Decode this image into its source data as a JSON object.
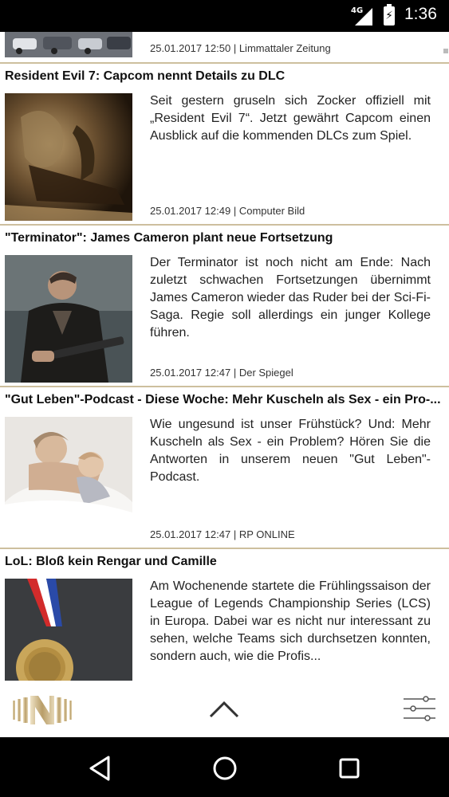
{
  "status_bar": {
    "network": "4G",
    "time": "1:36"
  },
  "articles": [
    {
      "title": "",
      "teaser": "",
      "date": "25.01.2017 12:50",
      "source": "Limmattaler Zeitung"
    },
    {
      "title": "Resident Evil 7: Capcom nennt Details zu DLC",
      "teaser": "Seit gestern gruseln sich Zocker offiziell mit „Resident Evil 7“. Jetzt gewährt Capcom einen Ausblick auf die kommenden DLCs zum Spiel.",
      "date": "25.01.2017 12:49",
      "source": "Computer Bild"
    },
    {
      "title": "\"Terminator\": James Cameron plant neue Fortsetzung",
      "teaser": "Der Terminator ist noch nicht am Ende: Nach zuletzt schwachen Fortsetzungen übernimmt James Cameron wieder das Ruder bei der Sci-Fi-Saga. Regie soll allerdings ein junger Kollege führen.",
      "date": "25.01.2017 12:47",
      "source": "Der Spiegel"
    },
    {
      "title": "\"Gut Leben\"-Podcast - Diese Woche: Mehr Kuscheln als Sex - ein Pro-...",
      "teaser": "Wie ungesund ist unser Frühstück? Und: Mehr Kuscheln als Sex - ein Problem? Hören Sie die Antworten in unserem neuen \"Gut Leben\"-Podcast.",
      "date": "25.01.2017 12:47",
      "source": "RP ONLINE"
    },
    {
      "title": "LoL: Bloß kein Rengar und Camille",
      "teaser": "Am Wochenende startete die Frühlingssaison der League of Legends Championship Series (LCS) in Europa. Dabei war es nicht nur interessant zu sehen, welche Teams sich durchsetzen konnten, sondern auch, wie die Profis...",
      "date": "",
      "source": ""
    }
  ],
  "meta_separator": " | ",
  "app_bar": {
    "logo_icon": "app-logo",
    "up_icon": "chevron-up-icon",
    "filter_icon": "sliders-icon"
  },
  "nav_bar": {
    "back_icon": "back-triangle-icon",
    "home_icon": "home-circle-icon",
    "recent_icon": "recent-square-icon"
  }
}
